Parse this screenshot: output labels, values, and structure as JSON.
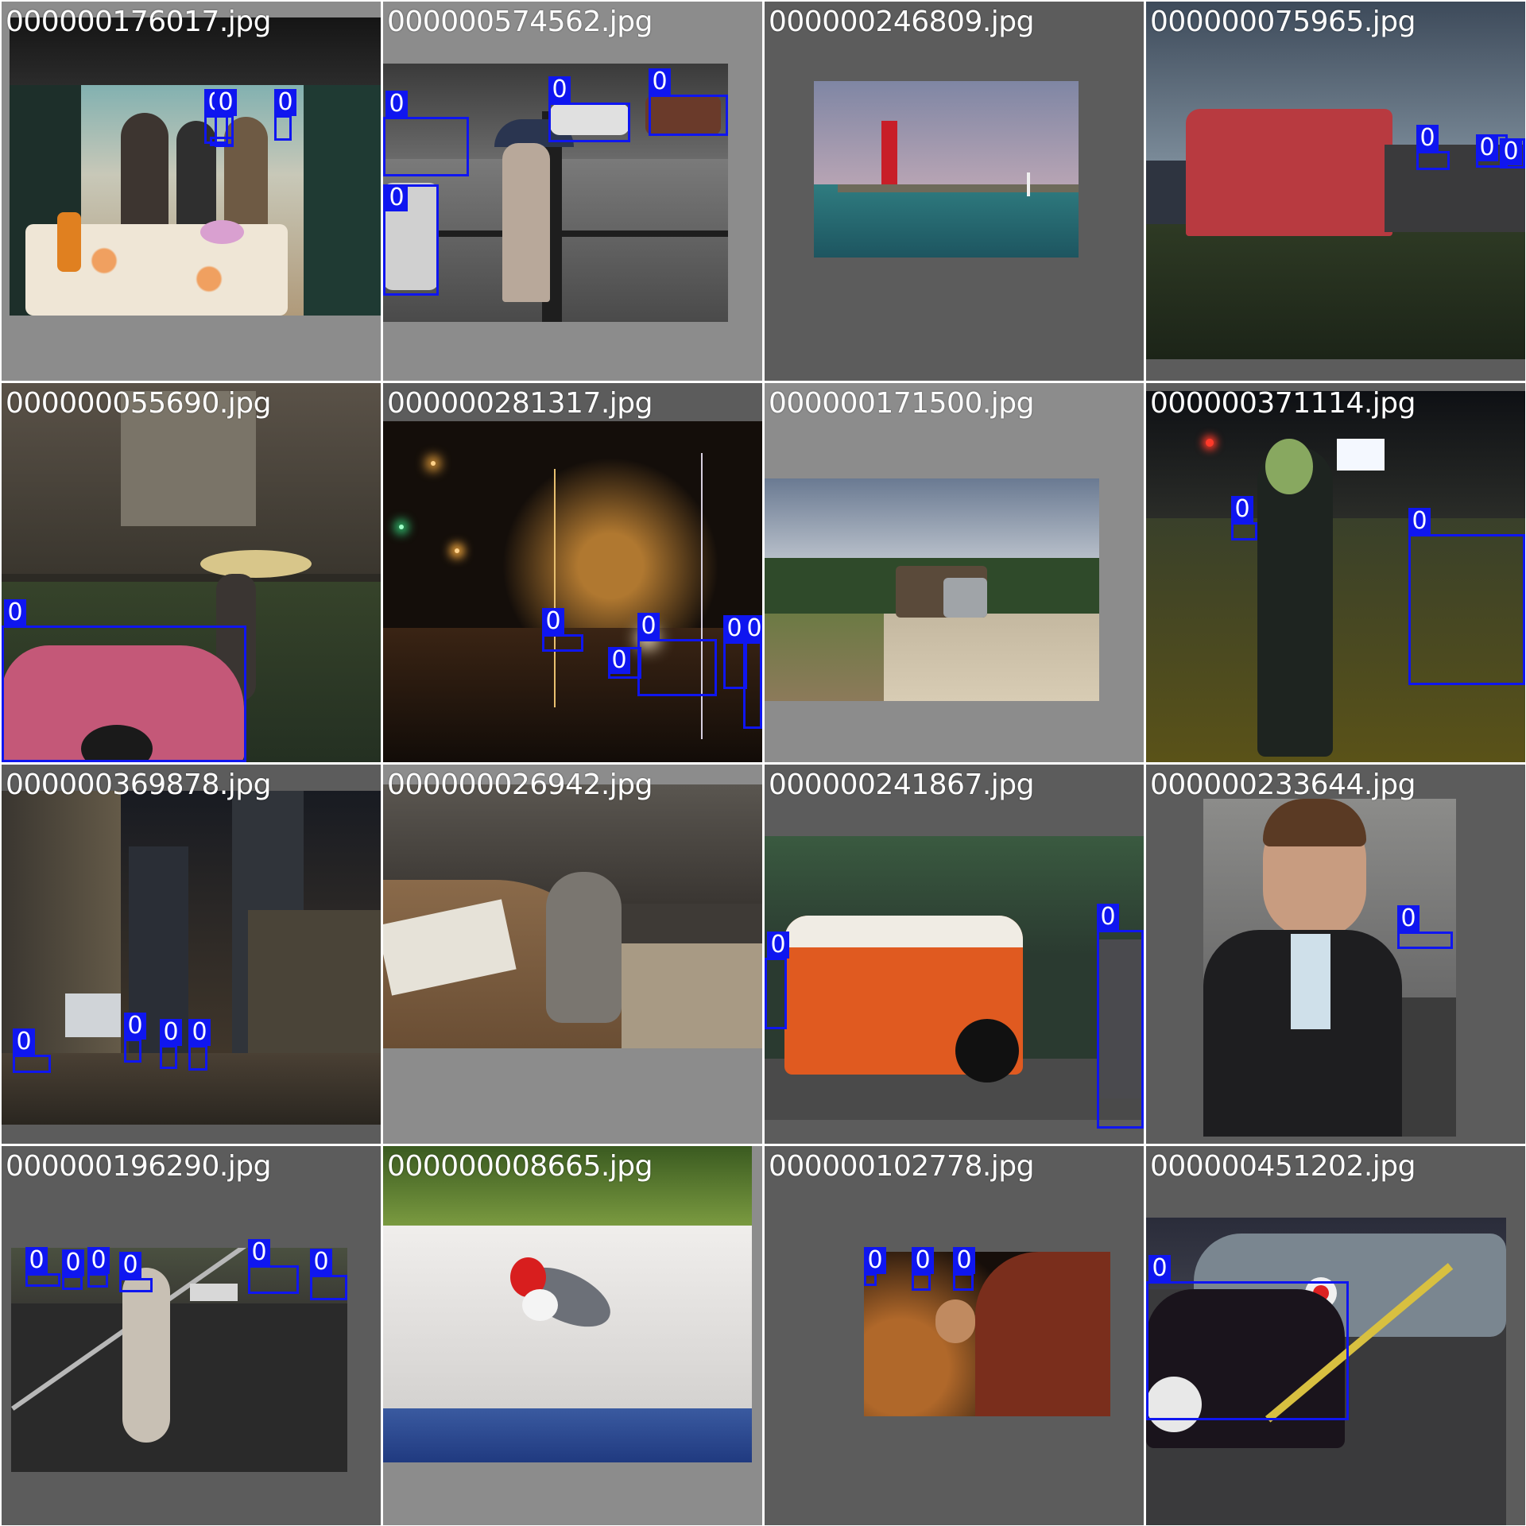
{
  "colors": {
    "box": "#0f16f0",
    "label_text": "#ffffff"
  },
  "tiles": [
    {
      "filename": "000000176017.jpg",
      "box_labels": [
        "0",
        "0",
        "0",
        "0"
      ]
    },
    {
      "filename": "000000574562.jpg",
      "box_labels": [
        "0",
        "0",
        "0",
        "0"
      ]
    },
    {
      "filename": "000000246809.jpg",
      "box_labels": []
    },
    {
      "filename": "000000075965.jpg",
      "box_labels": [
        "0",
        "0",
        "0"
      ]
    },
    {
      "filename": "000000055690.jpg",
      "box_labels": [
        "0"
      ]
    },
    {
      "filename": "000000281317.jpg",
      "box_labels": [
        "0",
        "0",
        "0",
        "0",
        "0"
      ]
    },
    {
      "filename": "000000171500.jpg",
      "box_labels": []
    },
    {
      "filename": "000000371114.jpg",
      "box_labels": [
        "0",
        "0"
      ]
    },
    {
      "filename": "000000369878.jpg",
      "box_labels": [
        "0",
        "0",
        "0",
        "0"
      ]
    },
    {
      "filename": "000000026942.jpg",
      "box_labels": []
    },
    {
      "filename": "000000241867.jpg",
      "box_labels": [
        "0",
        "0"
      ]
    },
    {
      "filename": "000000233644.jpg",
      "box_labels": [
        "0"
      ]
    },
    {
      "filename": "000000196290.jpg",
      "box_labels": [
        "0",
        "0",
        "0",
        "0",
        "0",
        "0"
      ]
    },
    {
      "filename": "000000008665.jpg",
      "box_labels": []
    },
    {
      "filename": "000000102778.jpg",
      "box_labels": [
        "0",
        "0",
        "0"
      ]
    },
    {
      "filename": "000000451202.jpg",
      "box_labels": [
        "0"
      ]
    }
  ]
}
